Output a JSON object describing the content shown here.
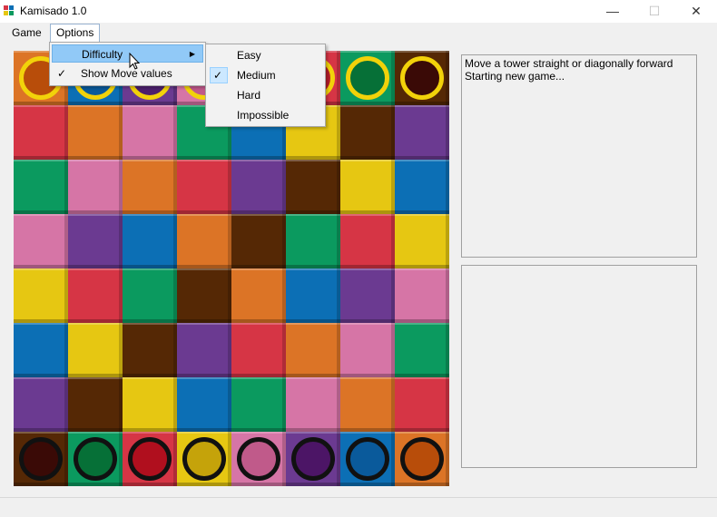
{
  "window": {
    "title": "Kamisado 1.0",
    "minimize_glyph": "—",
    "maximize_glyph": "☐",
    "close_glyph": "✕"
  },
  "menubar": {
    "game_label": "Game",
    "options_label": "Options"
  },
  "options_menu": {
    "difficulty_label": "Difficulty",
    "show_move_values_label": "Show Move values",
    "show_move_values_checked": true,
    "check_glyph": "✓",
    "submenu_glyph": "▶"
  },
  "difficulty_menu": {
    "items": [
      "Easy",
      "Medium",
      "Hard",
      "Impossible"
    ],
    "selected": "Medium"
  },
  "log": {
    "lines": [
      "Move a tower straight or diagonally forward",
      "Starting new game..."
    ]
  },
  "colors": {
    "orange": "#dc7426",
    "blue": "#0c6fb5",
    "purple": "#6b3a91",
    "pink": "#d675a6",
    "yellow": "#e6c712",
    "red": "#d63545",
    "green": "#0b9a5f",
    "brown": "#552805"
  },
  "board": {
    "rows": [
      [
        "orange",
        "blue",
        "purple",
        "pink",
        "yellow",
        "red",
        "green",
        "brown"
      ],
      [
        "red",
        "orange",
        "pink",
        "green",
        "blue",
        "yellow",
        "brown",
        "purple"
      ],
      [
        "green",
        "pink",
        "orange",
        "red",
        "purple",
        "brown",
        "yellow",
        "blue"
      ],
      [
        "pink",
        "purple",
        "blue",
        "orange",
        "brown",
        "green",
        "red",
        "yellow"
      ],
      [
        "yellow",
        "red",
        "green",
        "brown",
        "orange",
        "blue",
        "purple",
        "pink"
      ],
      [
        "blue",
        "yellow",
        "brown",
        "purple",
        "red",
        "orange",
        "pink",
        "green"
      ],
      [
        "purple",
        "brown",
        "yellow",
        "blue",
        "green",
        "pink",
        "orange",
        "red"
      ],
      [
        "brown",
        "green",
        "red",
        "yellow",
        "pink",
        "purple",
        "blue",
        "orange"
      ]
    ],
    "top_towers": {
      "ring_color": "#f2d20a",
      "fills": [
        "#b84d0a",
        "#0a5a9b",
        "#4c1f6d",
        "#c0588a",
        "#d4b80c",
        "#b61e2a",
        "#067037",
        "#3a0a06"
      ]
    },
    "bottom_towers": {
      "ring_color": "#111111",
      "fills": [
        "#3a0a06",
        "#067037",
        "#b00f1e",
        "#c5a30a",
        "#c05a8a",
        "#4c1566",
        "#0a5a9b",
        "#b84d0a"
      ]
    }
  }
}
